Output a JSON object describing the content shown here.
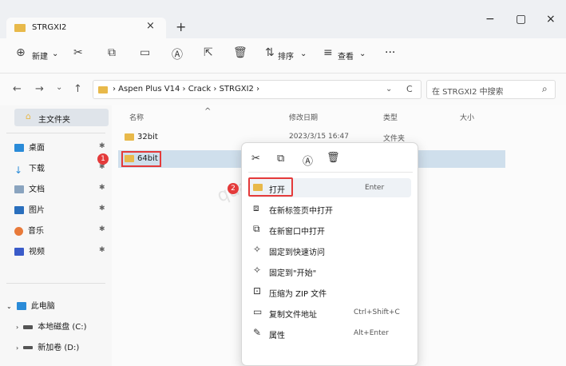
{
  "window": {
    "tab_title": "STRGXI2",
    "tab_close": "×",
    "new_tab": "+",
    "minimize": "−",
    "maximize": "▢",
    "close": "×"
  },
  "toolbar": {
    "new_label": "新建",
    "sort_label": "排序",
    "view_label": "查看",
    "more_label": "···",
    "dropdown_glyph": "⌄"
  },
  "navigation": {
    "back": "←",
    "forward": "→",
    "recent_glyph": "⌄",
    "up": "↑",
    "refresh": "C",
    "breadcrumb": "› Aspen Plus V14 › Crack › STRGXI2 ›",
    "search_placeholder": "在 STRGXI2 中搜索",
    "address_dropdown": "⌄"
  },
  "sidebar": {
    "home": "主文件夹",
    "items": [
      {
        "label": "桌面",
        "pinned": true
      },
      {
        "label": "下载",
        "pinned": true
      },
      {
        "label": "文档",
        "pinned": true
      },
      {
        "label": "图片",
        "pinned": true
      },
      {
        "label": "音乐",
        "pinned": true
      },
      {
        "label": "视频",
        "pinned": true
      }
    ],
    "pin_glyph": "✱",
    "this_pc": "此电脑",
    "drives": [
      "本地磁盘 (C:)",
      "新加卷 (D:)"
    ]
  },
  "columns": {
    "name": "名称",
    "modified": "修改日期",
    "type": "类型",
    "size": "大小"
  },
  "files": [
    {
      "name": "32bit",
      "modified": "2023/3/15 16:47",
      "type": "文件夹"
    },
    {
      "name": "64bit",
      "modified": "",
      "type": ""
    }
  ],
  "context_menu": {
    "items": [
      {
        "label": "打开",
        "shortcut": "Enter",
        "icon": "folder-icon"
      },
      {
        "label": "在新标签页中打开",
        "shortcut": "",
        "icon": "new-tab-icon"
      },
      {
        "label": "在新窗口中打开",
        "shortcut": "",
        "icon": "new-window-icon"
      },
      {
        "label": "固定到快速访问",
        "shortcut": "",
        "icon": "pin-icon"
      },
      {
        "label": "固定到\"开始\"",
        "shortcut": "",
        "icon": "pin-icon"
      },
      {
        "label": "压缩为 ZIP 文件",
        "shortcut": "",
        "icon": "zip-icon"
      },
      {
        "label": "复制文件地址",
        "shortcut": "Ctrl+Shift+C",
        "icon": "copy-path-icon"
      },
      {
        "label": "属性",
        "shortcut": "Alt+Enter",
        "icon": "properties-icon"
      }
    ]
  },
  "annotations": {
    "step1": "1",
    "step2": "2",
    "watermark": "quantmaster"
  },
  "colors": {
    "accent": "#0067c0",
    "folder": "#e8b94a",
    "highlight": "#e43a3a",
    "selection": "#cfdfec"
  }
}
